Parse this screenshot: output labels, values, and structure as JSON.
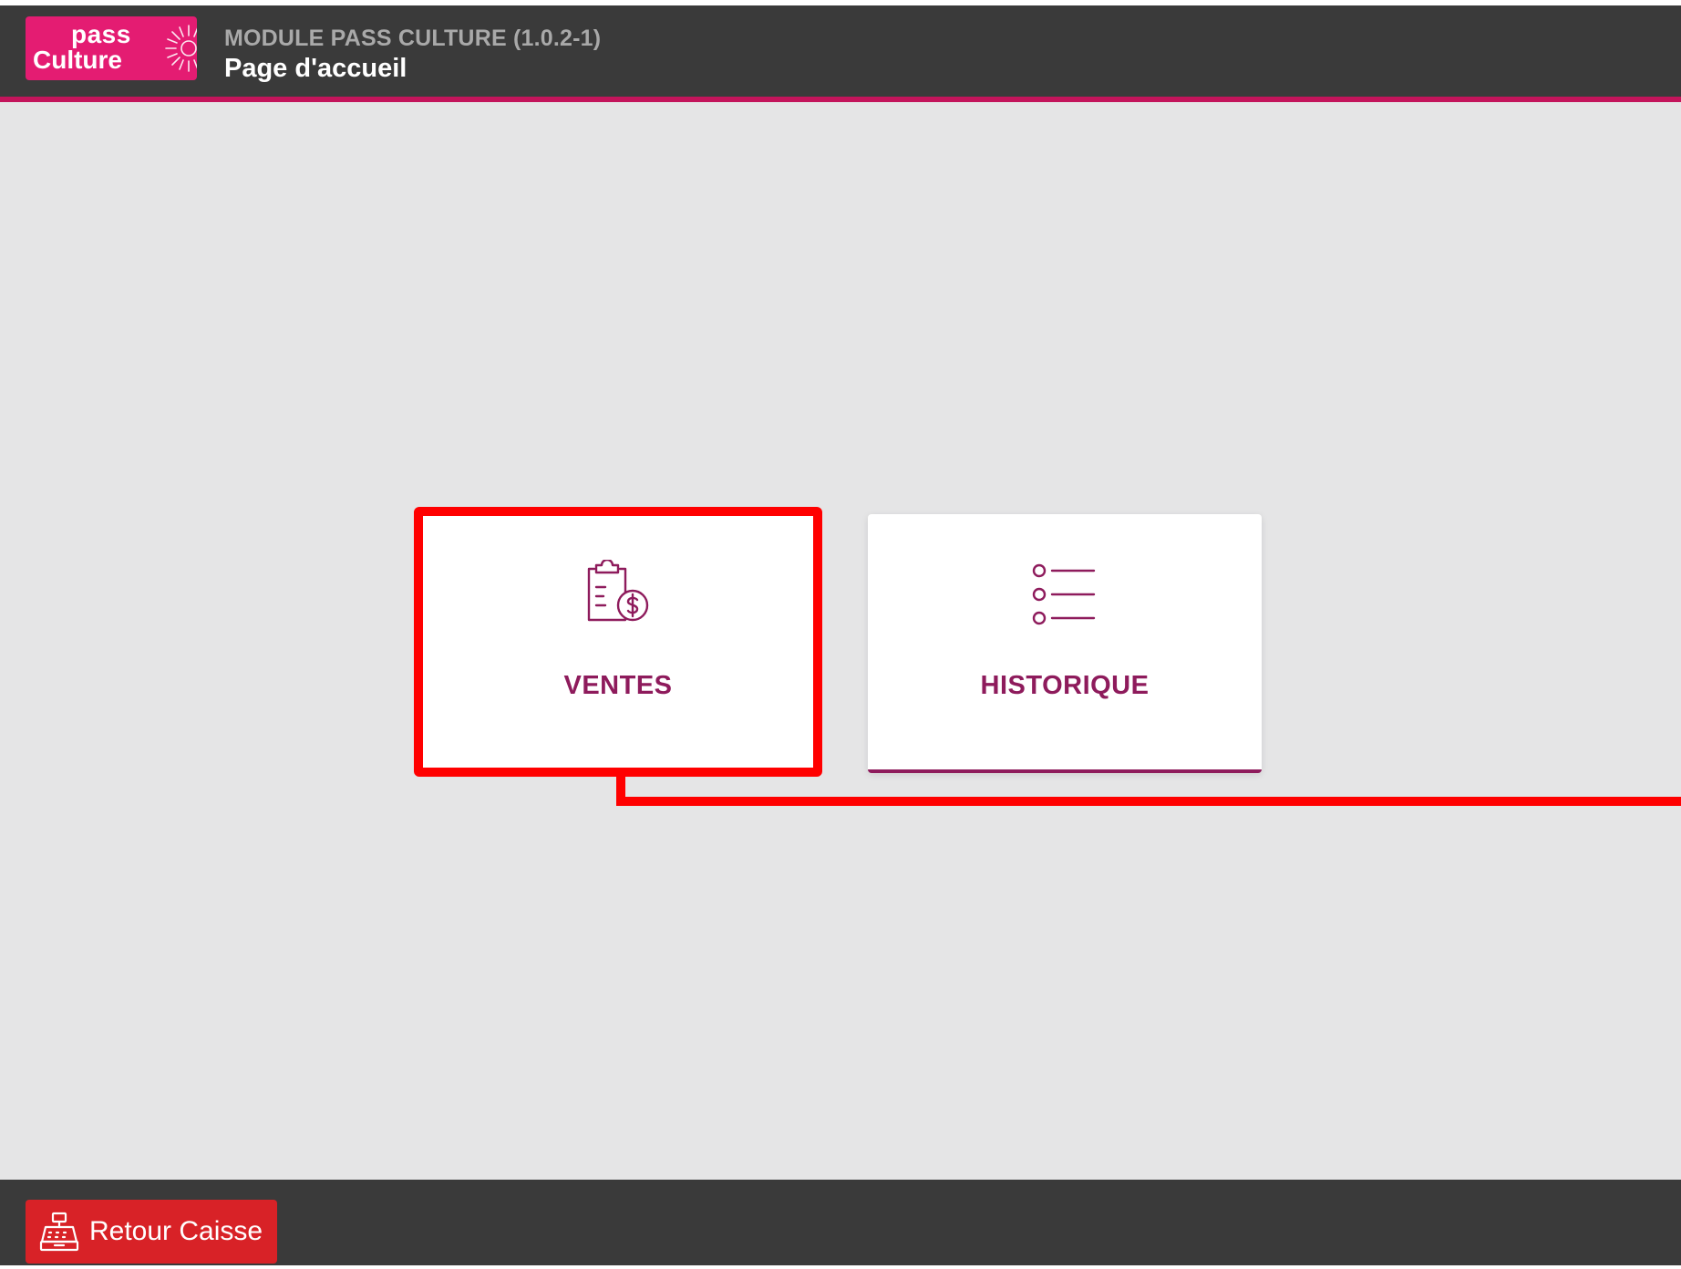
{
  "header": {
    "logo": {
      "line1": "pass",
      "line2": "Culture",
      "icon": "sun-icon"
    },
    "module": "MODULE PASS CULTURE (1.0.2-1)",
    "page_title": "Page d'accueil"
  },
  "tiles": [
    {
      "label": "VENTES",
      "icon": "clipboard-dollar-icon"
    },
    {
      "label": "HISTORIQUE",
      "icon": "list-icon"
    }
  ],
  "footer": {
    "retour_label": "Retour Caisse",
    "retour_icon": "cash-register-icon"
  },
  "colors": {
    "brand_pink": "#e41c72",
    "accent": "#8e1b5c",
    "header_bg": "#3a3a3a",
    "danger": "#d82227",
    "highlight": "#ff0000"
  }
}
